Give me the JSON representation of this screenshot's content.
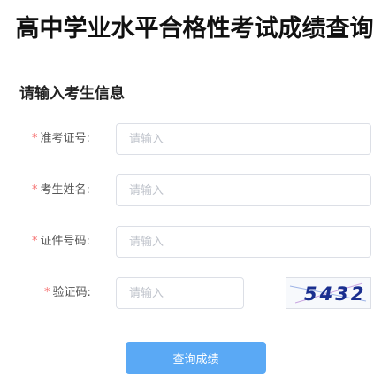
{
  "page": {
    "title": "高中学业水平合格性考试成绩查询"
  },
  "form": {
    "heading": "请输入考生信息",
    "required_mark": "*",
    "fields": [
      {
        "label": "准考证号:",
        "placeholder": "请输入",
        "value": ""
      },
      {
        "label": "考生姓名:",
        "placeholder": "请输入",
        "value": ""
      },
      {
        "label": "证件号码:",
        "placeholder": "请输入",
        "value": ""
      },
      {
        "label": "验证码:",
        "placeholder": "请输入",
        "value": ""
      }
    ],
    "captcha": {
      "text": "5432",
      "text_color": "#1a2f8f"
    },
    "submit_label": "查询成绩"
  },
  "colors": {
    "required": "#f56c6c",
    "button": "#5aa9f5",
    "input_border": "#dcdfe6"
  }
}
